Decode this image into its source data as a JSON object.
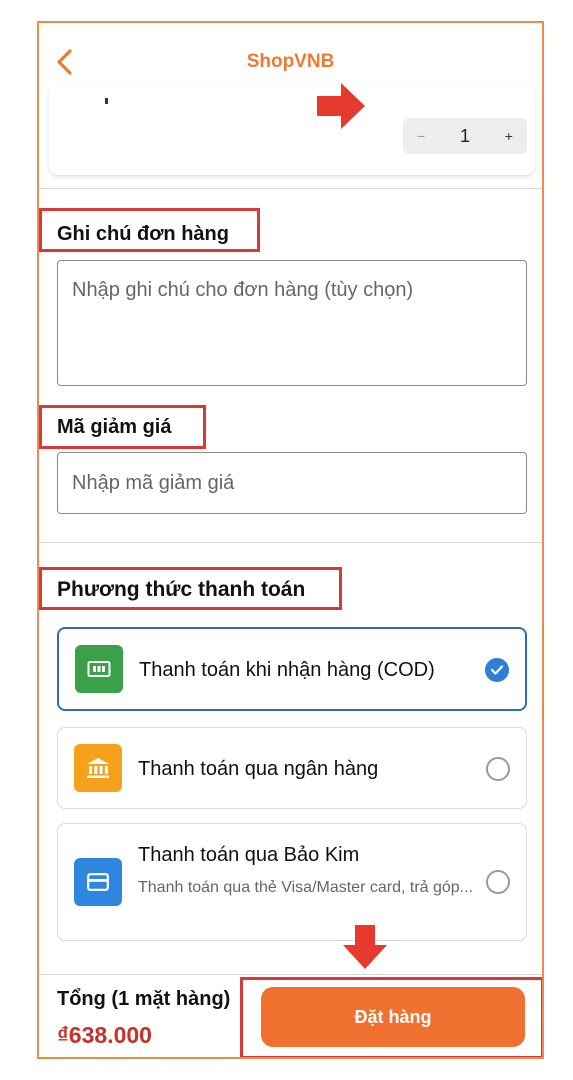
{
  "header": {
    "title": "ShopVNB"
  },
  "product": {
    "quantity": "1",
    "minus_symbol": "−",
    "plus_symbol": "+"
  },
  "order_note": {
    "label": "Ghi chú đơn hàng",
    "placeholder": "Nhập ghi chú cho đơn hàng (tùy chọn)",
    "value": ""
  },
  "discount": {
    "label": "Mã giảm giá",
    "placeholder": "Nhập mã giảm giá",
    "value": ""
  },
  "payment": {
    "label": "Phương thức thanh toán",
    "options": [
      {
        "label": "Thanh toán khi nhận hàng (COD)",
        "icon": "cash-icon",
        "color": "#3aa14a",
        "selected": true
      },
      {
        "label": "Thanh toán qua ngân hàng",
        "icon": "bank-icon",
        "color": "#f5a11c",
        "selected": false
      },
      {
        "label": "Thanh toán qua Bảo Kim",
        "description": "Thanh toán qua thẻ Visa/Master card, trả góp...",
        "icon": "credit-card-icon",
        "color": "#2f86de",
        "selected": false
      }
    ]
  },
  "footer": {
    "total_label": "Tổng (1 mặt hàng)",
    "total_value": "₫638.000",
    "order_button": "Đặt hàng"
  },
  "colors": {
    "brand": "#ee7a32",
    "order_button": "#f07030",
    "price": "#c8302c",
    "highlight_box": "#d83a3a",
    "selected_border": "#2f6fb0"
  }
}
